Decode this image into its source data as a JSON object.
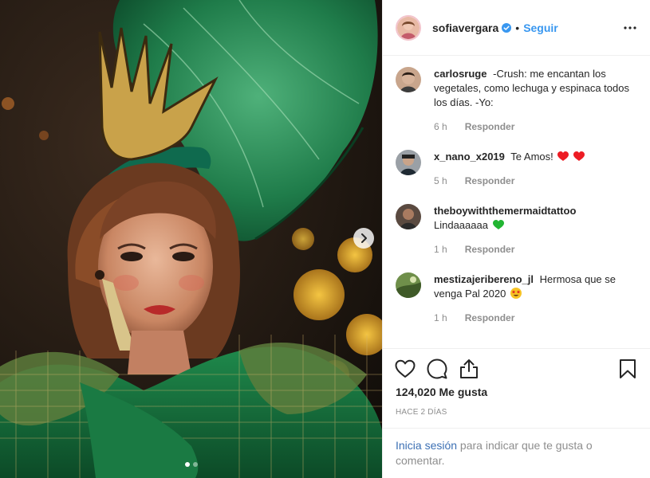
{
  "post": {
    "author": {
      "username": "sofiavergara",
      "verified": true,
      "follow_label": "Seguir",
      "separator": "•"
    },
    "next_image_icon": "chevron-right-icon",
    "carousel": {
      "count": 2,
      "active": 0
    },
    "comments": [
      {
        "username": "carlosruge",
        "text": "-Crush: me encantan los vegetales, como lechuga y espinaca todos los días. -Yo:",
        "time": "6 h",
        "reply_label": "Responder",
        "emoji": []
      },
      {
        "username": "x_nano_x2019",
        "text": "Te Amos!",
        "time": "5 h",
        "reply_label": "Responder",
        "emoji": [
          "red-heart",
          "red-heart"
        ]
      },
      {
        "username": "theboywiththemermaidtattoo",
        "text": "Lindaaaaaa",
        "time": "1 h",
        "reply_label": "Responder",
        "emoji": [
          "green-heart"
        ]
      },
      {
        "username": "mestizajeribereno_jl",
        "text": "Hermosa que se venga Pal 2020",
        "time": "1 h",
        "reply_label": "Responder",
        "emoji": [
          "star-struck-face"
        ]
      }
    ],
    "likes_label": "124,020 Me gusta",
    "time_ago": "HACE 2 DÍAS",
    "login_prompt": {
      "link": "Inicia sesión",
      "rest": " para indicar que te gusta o comentar."
    }
  },
  "colors": {
    "accent": "#3897f0",
    "muted": "#8e8e8e",
    "text": "#262626",
    "border": "#efefef",
    "heart_red": "#ed1c24",
    "heart_green": "#22b532"
  },
  "icons": [
    "more-options-icon",
    "heart-icon",
    "comment-icon",
    "share-icon",
    "bookmark-icon",
    "verified-badge-icon"
  ]
}
